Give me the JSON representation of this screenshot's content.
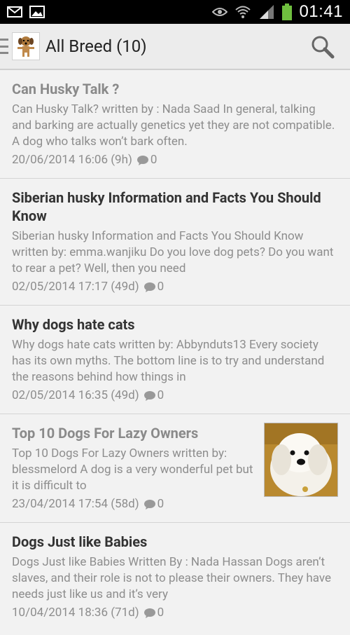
{
  "status_bar": {
    "time": "01:41",
    "icons": [
      "mail-icon",
      "image-icon",
      "eye-icon",
      "wifi-icon",
      "signal-icon",
      "battery-icon"
    ]
  },
  "action_bar": {
    "title": "All Breed (10)",
    "icons": [
      "drawer-icon",
      "app-logo-icon",
      "search-icon"
    ]
  },
  "articles": [
    {
      "title": "Can Husky Talk ?",
      "read": true,
      "snippet": "Can Husky Talk? written by : Nada Saad In general, talking and barking are actually genetics yet they are not compatible. A dog who talks won’t bark often.",
      "date": "20/06/2014 16:06 (9h)",
      "comments": "0"
    },
    {
      "title": "Siberian husky Information and Facts You Should Know",
      "read": false,
      "snippet": "Siberian husky Information and Facts You Should Know written by: emma.wanjiku Do you love dog pets? Do you want to rear a pet? Well, then you need",
      "date": "02/05/2014 17:17 (49d)",
      "comments": "0"
    },
    {
      "title": "Why dogs hate cats",
      "read": false,
      "snippet": "Why dogs hate cats written by: Abbynduts13 Every society has its own myths. The bottom line is to try and understand the reasons behind how things in",
      "date": "02/05/2014 16:35 (49d)",
      "comments": "0"
    },
    {
      "title": "Top 10 Dogs For Lazy Owners",
      "read": true,
      "snippet": "Top 10 Dogs For Lazy Owners written by: blessmelord A dog is a very wonderful pet but it is difficult to",
      "date": "23/04/2014 17:54 (58d)",
      "comments": "0",
      "thumbnail": "white-fluffy-dog-photo"
    },
    {
      "title": "Dogs Just like Babies",
      "read": false,
      "snippet": "Dogs Just like Babies Written By : Nada Hassan Dogs aren’t slaves, and their role is not to please their owners. They have needs just like us and it’s very",
      "date": "10/04/2014 18:36 (71d)",
      "comments": "0"
    }
  ]
}
